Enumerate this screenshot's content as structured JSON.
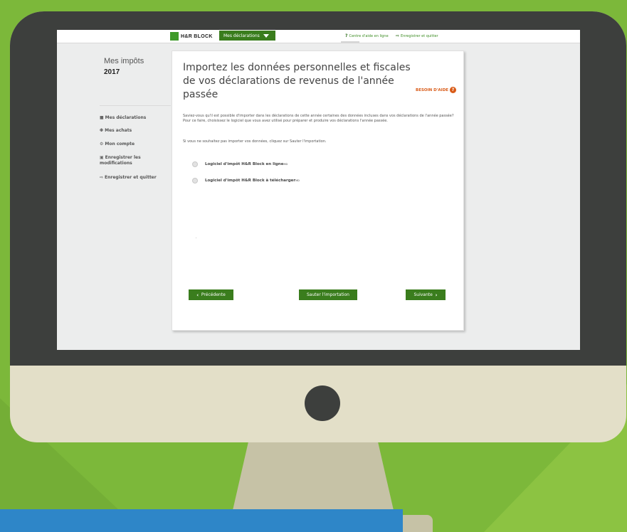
{
  "header": {
    "logo_text": "H&R BLOCK",
    "menu_label": "Mes déclarations",
    "help_link": "Centre d'aide en ligne",
    "save_link": "Enregistrer et quitter"
  },
  "sidebar": {
    "title": "Mes impôts",
    "year": "2017",
    "items": [
      {
        "label": "Mes déclarations",
        "icon": "folder-icon"
      },
      {
        "label": "Mes achats",
        "icon": "cart-icon"
      },
      {
        "label": "Mon compte",
        "icon": "gear-icon"
      },
      {
        "label": "Enregistrer les modifications",
        "icon": "save-icon"
      },
      {
        "label": "Enregistrer et quitter",
        "icon": "exit-icon"
      }
    ]
  },
  "main": {
    "title": "Importez les données personnelles et fiscales de vos déclarations de revenus de l'année passée",
    "help_label": "BESOIN D'AIDE",
    "paragraph1": "Saviez-vous qu'il est possible d'importer dans les déclarations de cette année certaines des données incluses dans vos déclarations de l'année passée? Pour ce faire, choisissez le logiciel que vous avez utilisé pour préparer et produire vos déclarations l'année passée.",
    "paragraph2": "Si vous ne souhaitez pas importer vos données, cliquez sur Sauter l'importation.",
    "options": [
      {
        "label": "Logiciel d'impôt H&R Block en ligne",
        "mark": "MD"
      },
      {
        "label": "Logiciel d'impôt H&R Block à télécharger",
        "mark": "MD"
      }
    ],
    "buttons": {
      "previous": "Précédente",
      "skip": "Sauter l'importation",
      "next": "Suivante"
    }
  },
  "colors": {
    "background_green": "#7cb83a",
    "brand_green": "#3a7d1d",
    "help_orange": "#d95b18",
    "monitor_dark": "#3d3f3d",
    "monitor_light": "#e3dfc8",
    "blue_bar": "#2e86c8"
  }
}
